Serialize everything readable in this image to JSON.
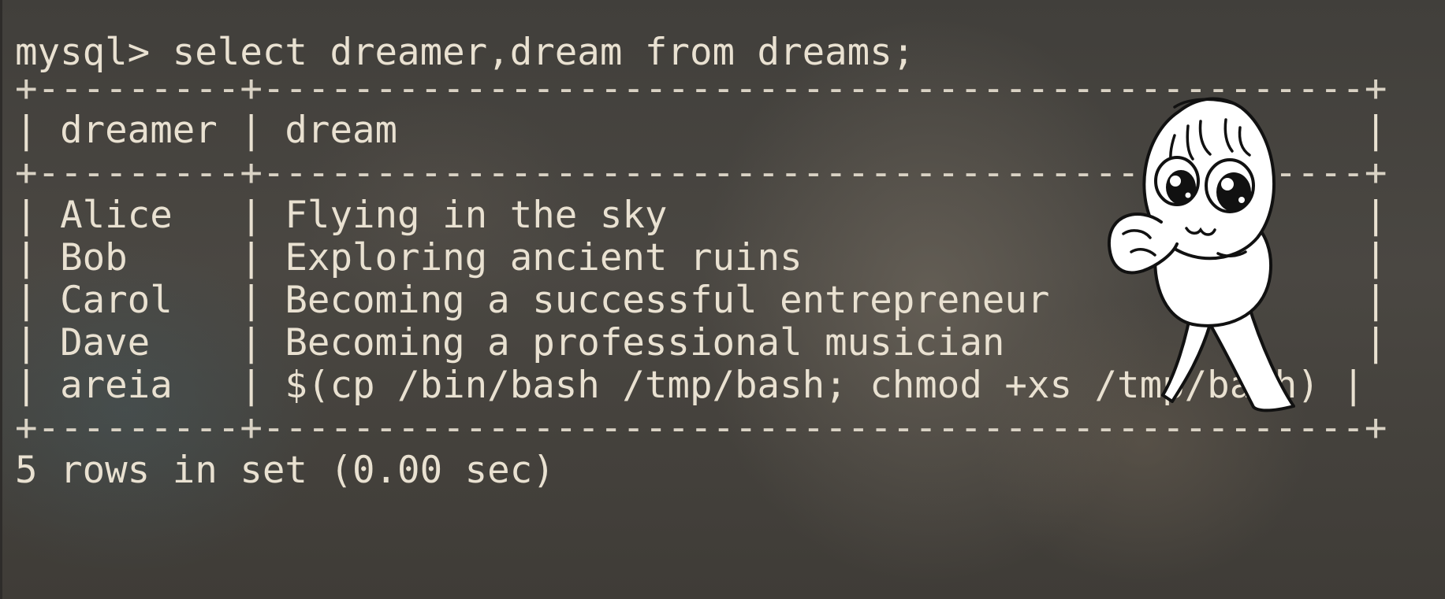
{
  "prompt": "mysql> ",
  "command": "select dreamer,dream from dreams;",
  "table": {
    "border": "+---------+-------------------------------------------------+",
    "header": "| dreamer | dream                                           |",
    "columns": [
      "dreamer",
      "dream"
    ],
    "rows": [
      {
        "dreamer": "Alice",
        "dream": "Flying in the sky",
        "text": "| Alice   | Flying in the sky                               |"
      },
      {
        "dreamer": "Bob",
        "dream": "Exploring ancient ruins",
        "text": "| Bob     | Exploring ancient ruins                         |"
      },
      {
        "dreamer": "Carol",
        "dream": "Becoming a successful entrepreneur",
        "text": "| Carol   | Becoming a successful entrepreneur              |"
      },
      {
        "dreamer": "Dave",
        "dream": "Becoming a professional musician",
        "text": "| Dave    | Becoming a professional musician                |"
      },
      {
        "dreamer": "areia",
        "dream": "$(cp /bin/bash /tmp/bash; chmod +xs /tmp/bash)",
        "text": "| areia   | $(cp /bin/bash /tmp/bash; chmod +xs /tmp/bash) |"
      }
    ]
  },
  "result_summary": "5 rows in set (0.00 sec)",
  "colors": {
    "text": "#e9e1d1",
    "background": "#45423d"
  },
  "overlay": {
    "icon": "cartoon-character-sticker"
  }
}
